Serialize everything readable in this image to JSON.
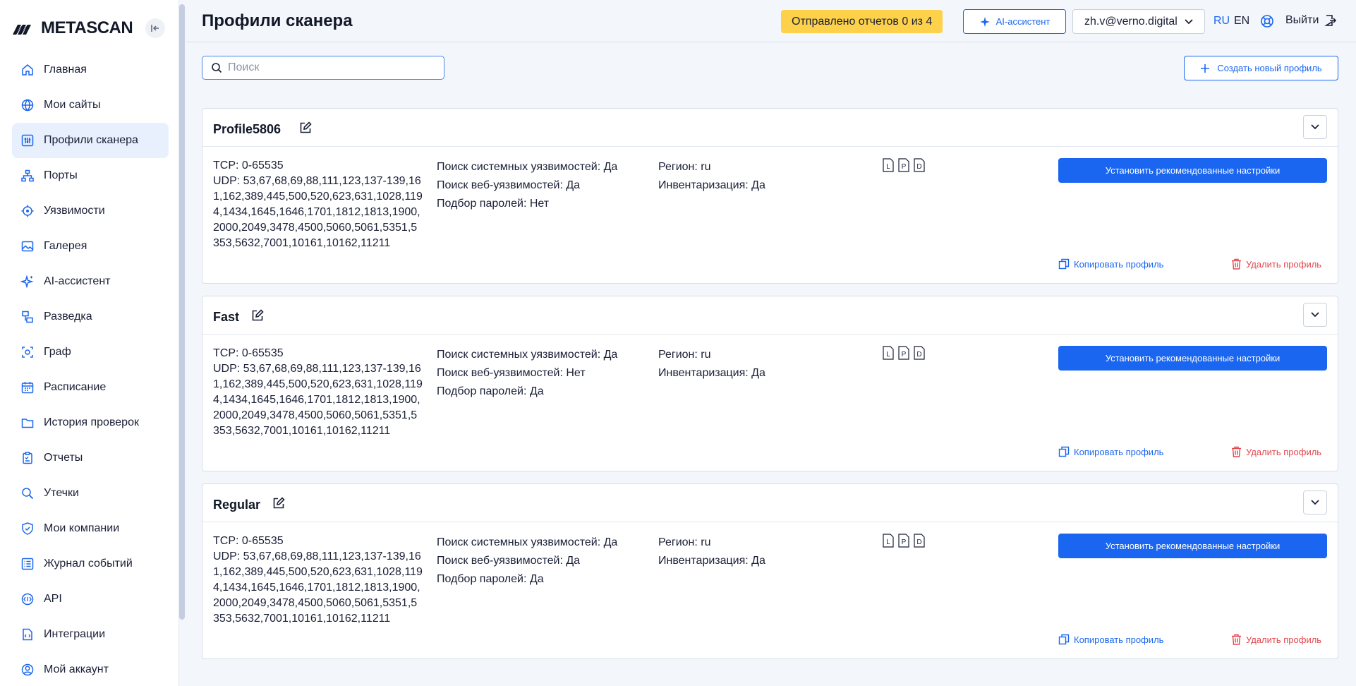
{
  "brand": {
    "name": "METASCAN"
  },
  "sidebar": {
    "items": [
      {
        "label": "Главная",
        "icon": "home-icon"
      },
      {
        "label": "Мои сайты",
        "icon": "globe-icon"
      },
      {
        "label": "Профили сканера",
        "icon": "sliders-icon",
        "active": true
      },
      {
        "label": "Порты",
        "icon": "network-icon"
      },
      {
        "label": "Уязвимости",
        "icon": "target-icon"
      },
      {
        "label": "Галерея",
        "icon": "image-icon"
      },
      {
        "label": "AI-ассистент",
        "icon": "sparkle-icon"
      },
      {
        "label": "Разведка",
        "icon": "recon-icon"
      },
      {
        "label": "Граф",
        "icon": "graph-icon"
      },
      {
        "label": "Расписание",
        "icon": "calendar-icon"
      },
      {
        "label": "История проверок",
        "icon": "folder-icon"
      },
      {
        "label": "Отчеты",
        "icon": "clipboard-icon"
      },
      {
        "label": "Утечки",
        "icon": "search-icon"
      },
      {
        "label": "Мои компании",
        "icon": "shield-icon"
      },
      {
        "label": "Журнал событий",
        "icon": "list-icon"
      },
      {
        "label": "API",
        "icon": "api-icon"
      },
      {
        "label": "Интеграции",
        "icon": "code-file-icon"
      },
      {
        "label": "Мой аккаунт",
        "icon": "user-icon"
      }
    ]
  },
  "header": {
    "title": "Профили сканера",
    "reports_badge": "Отправлено отчетов 0 из 4",
    "ai_button": "AI-ассистент",
    "user_email": "zh.v@verno.digital",
    "lang_ru": "RU",
    "lang_en": "EN",
    "logout": "Выйти"
  },
  "toolbar": {
    "search_placeholder": "Поиск",
    "search_value": "",
    "create_button": "Создать новый профиль"
  },
  "profiles": [
    {
      "name": "Profile5806",
      "tcp": "TCP: 0-65535",
      "udp": "UDP: 53,67,68,69,88,111,123,137-139,161,162,389,445,500,520,623,631,1028,1194,1434,1645,1646,1701,1812,1813,1900,2000,2049,3478,4500,5060,5061,5351,5353,5632,7001,10161,10162,11211",
      "sys_vuln": "Поиск системных уязвимостей: Да",
      "web_vuln": "Поиск веб-уязвимостей: Да",
      "passwords": "Подбор паролей: Нет",
      "region": "Регион: ru",
      "inventory": "Инвентаризация: Да"
    },
    {
      "name": "Fast",
      "tcp": "TCP: 0-65535",
      "udp": "UDP: 53,67,68,69,88,111,123,137-139,161,162,389,445,500,520,623,631,1028,1194,1434,1645,1646,1701,1812,1813,1900,2000,2049,3478,4500,5060,5061,5351,5353,5632,7001,10161,10162,11211",
      "sys_vuln": "Поиск системных уязвимостей: Да",
      "web_vuln": "Поиск веб-уязвимостей: Нет",
      "passwords": "Подбор паролей: Да",
      "region": "Регион: ru",
      "inventory": "Инвентаризация: Да"
    },
    {
      "name": "Regular",
      "tcp": "TCP: 0-65535",
      "udp": "UDP: 53,67,68,69,88,111,123,137-139,161,162,389,445,500,520,623,631,1028,1194,1434,1645,1646,1701,1812,1813,1900,2000,2049,3478,4500,5060,5061,5351,5353,5632,7001,10161,10162,11211",
      "sys_vuln": "Поиск системных уязвимостей: Да",
      "web_vuln": "Поиск веб-уязвимостей: Да",
      "passwords": "Подбор паролей: Да",
      "region": "Регион: ru",
      "inventory": "Инвентаризация: Да"
    }
  ],
  "card_actions": {
    "apply": "Установить рекомендованные настройки",
    "copy": "Копировать профиль",
    "delete": "Удалить профиль",
    "file_letters": [
      "L",
      "P",
      "D"
    ]
  },
  "colors": {
    "accent": "#1a66f0",
    "badge": "#fdd24a",
    "danger": "#e2474e",
    "active_nav": "#e8f0fd"
  }
}
